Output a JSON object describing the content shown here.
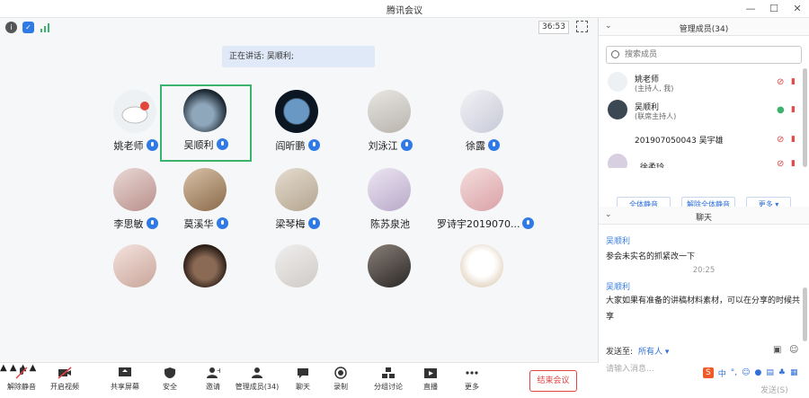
{
  "window": {
    "title": "腾讯会议",
    "controls": [
      "minimize-icon",
      "maximize-icon",
      "close-icon"
    ]
  },
  "meeting": {
    "timer": "36:53",
    "speaking_label": "正在讲话: 吴顺利;",
    "status_icons": [
      "info-icon",
      "shield-icon",
      "signal-icon"
    ]
  },
  "participants": [
    {
      "name": "姚老师",
      "mic": true
    },
    {
      "name": "吴顺利",
      "mic": true,
      "selected": true
    },
    {
      "name": "阎昕鹏",
      "mic": true
    },
    {
      "name": "刘泳江",
      "mic": true
    },
    {
      "name": "徐露",
      "mic": true
    },
    {
      "name": "李思敏",
      "mic": true
    },
    {
      "name": "莫溪华",
      "mic": true
    },
    {
      "name": "梁琴梅",
      "mic": true
    },
    {
      "name": "陈苏泉池",
      "mic": false
    },
    {
      "name": "罗诗宇2019070...",
      "mic": true
    },
    {
      "name": "",
      "mic": false
    },
    {
      "name": "",
      "mic": false
    },
    {
      "name": "",
      "mic": false
    },
    {
      "name": "",
      "mic": false
    },
    {
      "name": "",
      "mic": false
    }
  ],
  "toolbar": {
    "unmute": "解除静音",
    "start_video": "开启视频",
    "share_screen": "共享屏幕",
    "security": "安全",
    "invite": "邀请",
    "manage_members": "管理成员(34)",
    "chat": "聊天",
    "record": "录制",
    "breakout": "分组讨论",
    "live": "直播",
    "more": "更多",
    "end_meeting": "结束会议"
  },
  "members_panel": {
    "title": "管理成员(34)",
    "search_placeholder": "搜索成员",
    "members": [
      {
        "name": "姚老师",
        "role": "(主持人, 我)",
        "mic_muted": true
      },
      {
        "name": "吴顺利",
        "role": "(联席主持人)",
        "mic_muted": false
      },
      {
        "name": "201907050043 吴宇雄",
        "role": "",
        "mic_muted": true
      },
      {
        "name": "徐柔玲",
        "role": "",
        "mic_muted": true
      }
    ],
    "mute_all": "全体静音",
    "unmute_all": "解除全体静音",
    "more": "更多"
  },
  "chat_panel": {
    "title": "聊天",
    "messages": [
      {
        "sender": "吴顺利",
        "text": "参会未实名的抓紧改一下"
      },
      {
        "time": "20:25"
      },
      {
        "sender": "吴顺利",
        "text": "大家如果有准备的讲稿材料素材，可以在分享的时候共享"
      }
    ],
    "send_to_label": "发送至:",
    "send_to_value": "所有人",
    "input_placeholder": "请输入消息...",
    "send_label": "发送(S)"
  },
  "colors": {
    "accent": "#2f7ae5",
    "selected_border": "#3cb36c",
    "end_red": "#e04343"
  }
}
